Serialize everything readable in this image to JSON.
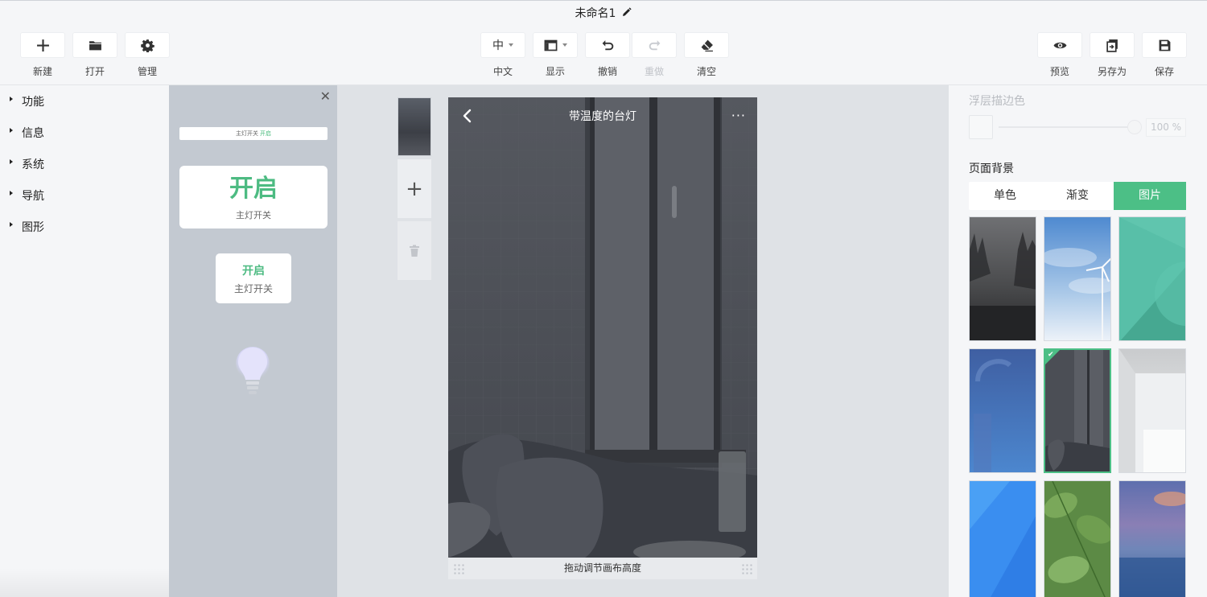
{
  "document": {
    "title": "未命名1"
  },
  "toolbar": {
    "left": [
      {
        "label": "新建",
        "icon": "plus-icon"
      },
      {
        "label": "打开",
        "icon": "folder-icon"
      },
      {
        "label": "管理",
        "icon": "gear-icon"
      }
    ],
    "center": {
      "language": {
        "value": "中",
        "label": "中文"
      },
      "display": {
        "label": "显示"
      },
      "undo": {
        "label": "撤销"
      },
      "redo": {
        "label": "重做",
        "disabled": true
      },
      "clear": {
        "label": "清空"
      }
    },
    "right": [
      {
        "label": "预览",
        "icon": "eye-icon"
      },
      {
        "label": "另存为",
        "icon": "save-as-icon"
      },
      {
        "label": "保存",
        "icon": "save-icon"
      }
    ]
  },
  "sidebar": {
    "items": [
      {
        "label": "功能"
      },
      {
        "label": "信息"
      },
      {
        "label": "系统"
      },
      {
        "label": "导航"
      },
      {
        "label": "图形"
      }
    ]
  },
  "components": {
    "close": "✕",
    "bar": {
      "label": "主灯开关",
      "state": "开启"
    },
    "big_card": {
      "state": "开启",
      "label": "主灯开关"
    },
    "small_card": {
      "state": "开启",
      "label": "主灯开关"
    },
    "bulb_icon": "light-bulb-icon"
  },
  "canvas": {
    "phone_title": "带温度的台灯",
    "more": "···",
    "resize_hint": "拖动调节画布高度",
    "add": "+"
  },
  "right_panel": {
    "float_border_color_label": "浮层描边色",
    "opacity": "100 %",
    "opacity_value": 1.0,
    "page_background_label": "页面背景",
    "bg_tabs": [
      {
        "label": "单色",
        "active": false
      },
      {
        "label": "渐变",
        "active": false
      },
      {
        "label": "图片",
        "active": true
      }
    ],
    "selected_background_index": 4
  },
  "colors": {
    "accent": "#4cbf86",
    "toggle_on": "#4dbb82",
    "canvas_bg": "#dfe2e6"
  }
}
